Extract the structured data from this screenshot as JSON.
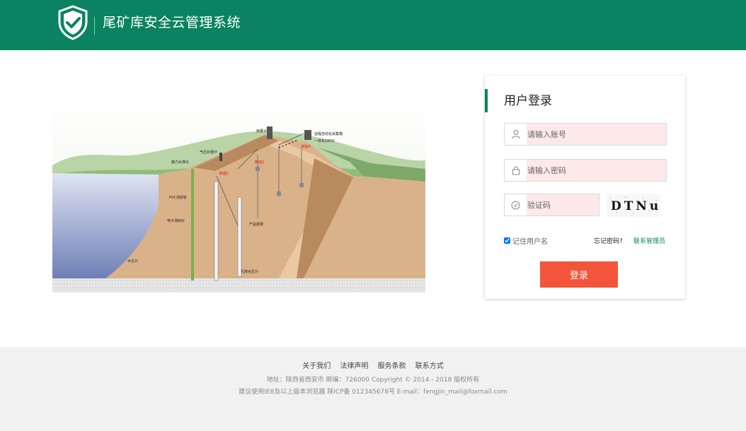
{
  "header": {
    "title": "尾矿库安全云管理系统",
    "bg_color": "#0b8360",
    "logo_icon": "shield-check-icon"
  },
  "illustration": {
    "labels": {
      "rain_gauge": "雨量计",
      "remote_station": "远程自动化采集箱",
      "gnss": "一体化GNSS",
      "pressure_gauge": "气压补偿计",
      "static_level": "静力水准仪",
      "section1": "断面1",
      "section2": "断面2",
      "section3": "断面3",
      "pvc_pipe": "PVC测斜管",
      "electronic_inclinometer": "电子测斜仪",
      "crack_meter": "产品竖桡",
      "water_level": "水位计",
      "piezometer": "孔隙水压计"
    }
  },
  "login": {
    "title": "用户登录",
    "account_placeholder": "请输入账号",
    "password_placeholder": "请输入密码",
    "captcha_placeholder": "验证码",
    "captcha_text": "DTNu",
    "remember_label": "记住用户名",
    "remember_checked": true,
    "forgot_label": "忘记密码?",
    "contact_label": "联系管理员",
    "submit_label": "登录",
    "button_color": "#f4553a"
  },
  "footer": {
    "links": [
      "关于我们",
      "法律声明",
      "服务条款",
      "联系方式"
    ],
    "address_line": "地址：陕西省西安市 邮编：726000  Copyright © 2014 - 2018 版权所有",
    "browser_line": "建议使用IE8及以上版本浏览器 陕ICP备 012345678号 E-mail：fengjin_mail@foxmail.com"
  }
}
